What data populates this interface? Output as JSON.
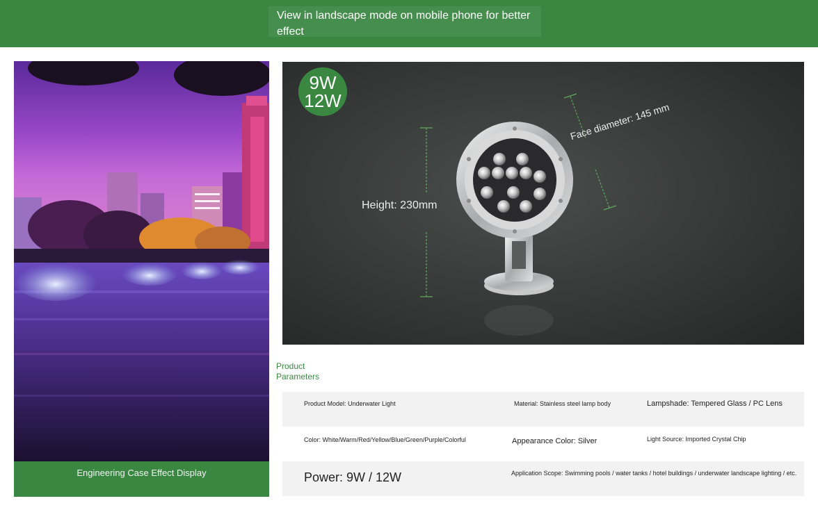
{
  "header": {
    "notice": "View in landscape mode on mobile phone for better effect"
  },
  "case_display": {
    "caption": "Engineering Case Effect Display"
  },
  "product_image": {
    "badge_line1": "9W",
    "badge_line2": "12W",
    "height_label": "Height: 230mm",
    "face_label": "Face diameter: 145 mm"
  },
  "parameters": {
    "title": "Product Parameters",
    "model": "Product Model: Underwater Light",
    "material": "Material: Stainless steel lamp body",
    "lampshade": "Lampshade: Tempered Glass / PC Lens",
    "color": "Color: White/Warm/Red/Yellow/Blue/Green/Purple/Colorful",
    "appearance": "Appearance Color: Silver",
    "light_source": "Light Source: Imported Crystal Chip",
    "power": "Power: 9W / 12W",
    "application": "Application Scope: Swimming pools / water tanks / hotel buildings / underwater landscape lighting / etc."
  },
  "colors": {
    "brand_green": "#3a8742",
    "row_gray": "#f2f2f2"
  }
}
